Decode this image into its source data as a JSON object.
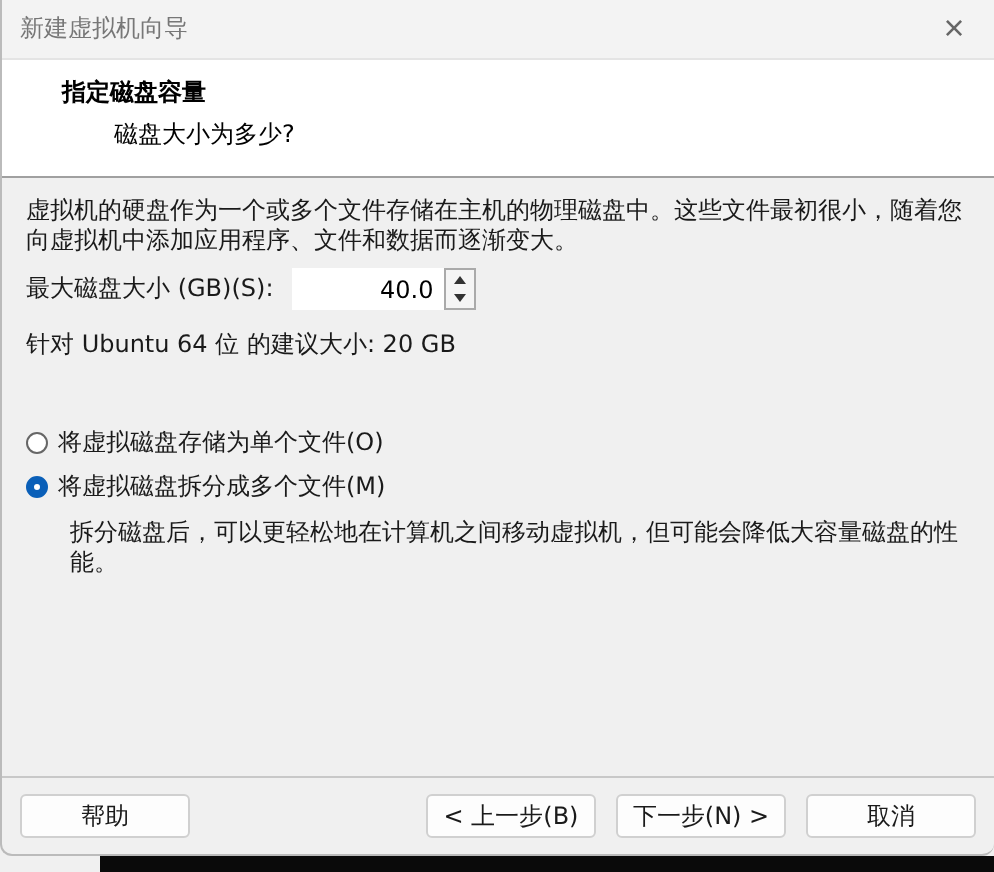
{
  "window": {
    "title": "新建虚拟机向导",
    "close": "×"
  },
  "header": {
    "title": "指定磁盘容量",
    "subtitle": "磁盘大小为多少?"
  },
  "intro": "虚拟机的硬盘作为一个或多个文件存储在主机的物理磁盘中。这些文件最初很小，随着您向虚拟机中添加应用程序、文件和数据而逐渐变大。",
  "disk_size": {
    "label": "最大磁盘大小 (GB)(S):",
    "value": "40.0"
  },
  "recommendation": "针对 Ubuntu 64 位 的建议大小: 20 GB",
  "storage_options": [
    {
      "label": "将虚拟磁盘存储为单个文件(O)",
      "selected": false
    },
    {
      "label": "将虚拟磁盘拆分成多个文件(M)",
      "selected": true,
      "description": "拆分磁盘后，可以更轻松地在计算机之间移动虚拟机，但可能会降低大容量磁盘的性能。"
    }
  ],
  "buttons": [
    {
      "label": "帮助",
      "kind": "help"
    },
    {
      "label": "< 上一步(B)",
      "kind": "nav"
    },
    {
      "label": "下一步(N) >",
      "kind": "nav"
    },
    {
      "label": "取消",
      "kind": "nav"
    }
  ]
}
